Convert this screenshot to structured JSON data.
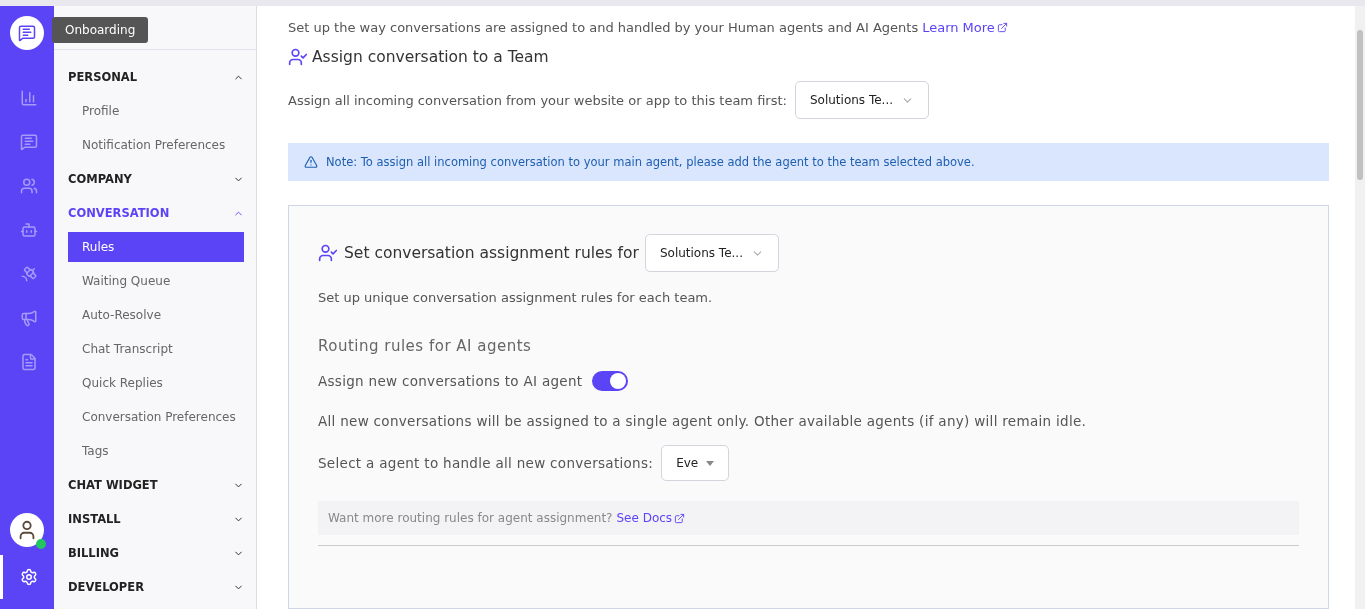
{
  "tooltip": "Onboarding",
  "sidebar": {
    "sections": [
      {
        "label": "PERSONAL",
        "expanded": true,
        "selected": false,
        "items": [
          {
            "label": "Profile",
            "selected": false
          },
          {
            "label": "Notification Preferences",
            "selected": false
          }
        ]
      },
      {
        "label": "COMPANY",
        "expanded": false,
        "selected": false
      },
      {
        "label": "CONVERSATION",
        "expanded": true,
        "selected": true,
        "items": [
          {
            "label": "Rules",
            "selected": true
          },
          {
            "label": "Waiting Queue",
            "selected": false
          },
          {
            "label": "Auto-Resolve",
            "selected": false
          },
          {
            "label": "Chat Transcript",
            "selected": false
          },
          {
            "label": "Quick Replies",
            "selected": false
          },
          {
            "label": "Conversation Preferences",
            "selected": false
          },
          {
            "label": "Tags",
            "selected": false
          }
        ]
      },
      {
        "label": "CHAT WIDGET",
        "expanded": false,
        "selected": false
      },
      {
        "label": "INSTALL",
        "expanded": false,
        "selected": false
      },
      {
        "label": "BILLING",
        "expanded": false,
        "selected": false
      },
      {
        "label": "DEVELOPER",
        "expanded": false,
        "selected": false
      }
    ]
  },
  "user": {
    "online": true
  },
  "main": {
    "intro": "Set up the way conversations are assigned to and handled by your Human agents and AI Agents",
    "intro_link": "Learn More",
    "team_heading": "Assign conversation to a Team",
    "team_label": "Assign all incoming conversation from your website or app to this team first:",
    "team_value": "Solutions Te...",
    "note": "Note: To assign all incoming conversation to your main agent, please add the agent to the team selected above.",
    "card": {
      "heading": "Set conversation assignment rules for",
      "team_value": "Solutions Te...",
      "description": "Set up unique conversation assignment rules for each team.",
      "subheading": "Routing rules for AI agents",
      "toggle_label": "Assign new conversations to AI agent",
      "toggle_on": true,
      "toggle_description": "All new conversations will be assigned to a single agent only. Other available agents (if any) will remain idle.",
      "agent_label": "Select a agent to handle all new conversations:",
      "agent_value": "Eve",
      "tip": "Want more routing rules for agent assignment?",
      "tip_link": "See Docs"
    }
  }
}
